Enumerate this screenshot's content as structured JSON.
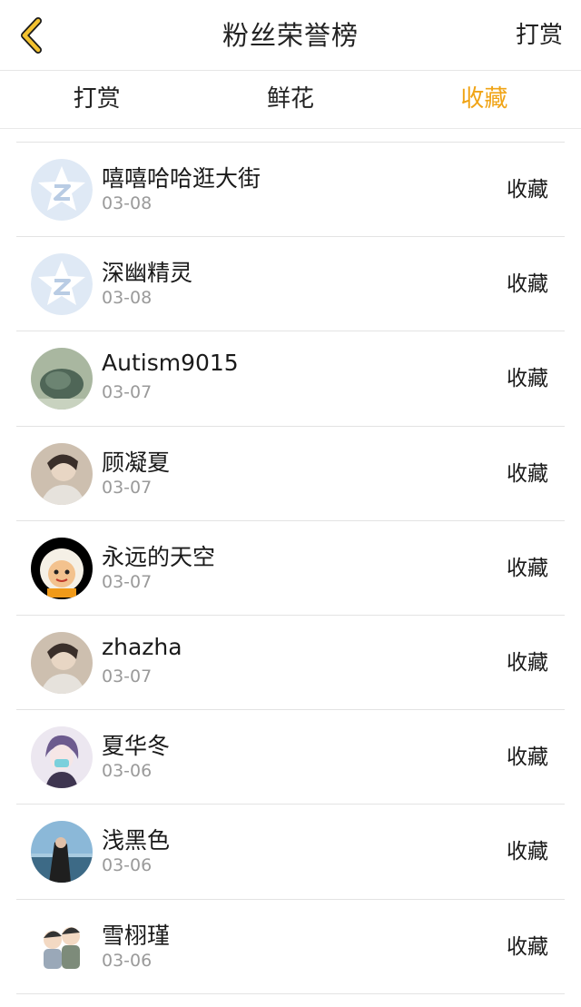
{
  "navbar": {
    "title": "粉丝荣誉榜",
    "right_action": "打赏"
  },
  "tabs": [
    {
      "label": "打赏",
      "active": false
    },
    {
      "label": "鲜花",
      "active": false
    },
    {
      "label": "收藏",
      "active": true
    }
  ],
  "colors": {
    "accent": "#f0a416",
    "text": "#1a1a1a",
    "muted": "#9a9a9a",
    "divider": "#e3e3e3"
  },
  "list": [
    {
      "name": "嘻嘻哈哈逛大街",
      "date": "03-08",
      "action": "收藏",
      "avatar": "default-star-avatar"
    },
    {
      "name": "深幽精灵",
      "date": "03-08",
      "action": "收藏",
      "avatar": "default-star-avatar"
    },
    {
      "name": "Autism9015",
      "date": "03-07",
      "action": "收藏",
      "avatar": "turtle-photo-avatar"
    },
    {
      "name": "顾凝夏",
      "date": "03-07",
      "action": "收藏",
      "avatar": "portrait-photo-avatar"
    },
    {
      "name": "永远的天空",
      "date": "03-07",
      "action": "收藏",
      "avatar": "cartoon-sheep-avatar"
    },
    {
      "name": "zhazha",
      "date": "03-07",
      "action": "收藏",
      "avatar": "portrait-photo-avatar"
    },
    {
      "name": "夏华冬",
      "date": "03-06",
      "action": "收藏",
      "avatar": "anime-character-avatar"
    },
    {
      "name": "浅黑色",
      "date": "03-06",
      "action": "收藏",
      "avatar": "beach-photo-avatar"
    },
    {
      "name": "雪栩瑾",
      "date": "03-06",
      "action": "收藏",
      "avatar": "cartoon-couple-avatar"
    }
  ]
}
